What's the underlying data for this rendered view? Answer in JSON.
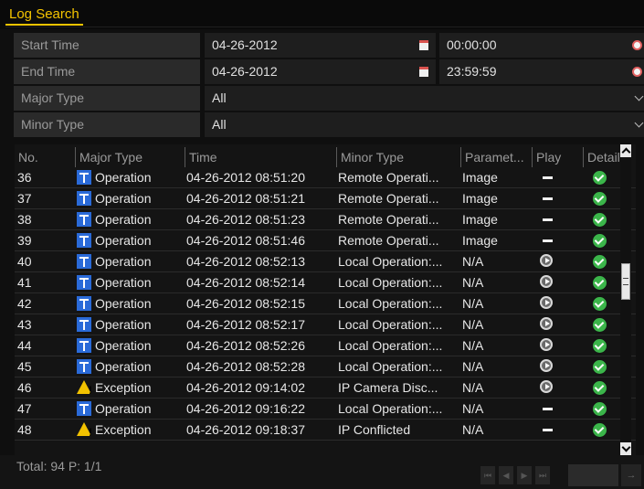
{
  "title_tab": "Log Search",
  "filters": {
    "start": {
      "label": "Start Time",
      "date": "04-26-2012",
      "time": "00:00:00"
    },
    "end": {
      "label": "End Time",
      "date": "04-26-2012",
      "time": "23:59:59"
    },
    "major": {
      "label": "Major Type",
      "value": "All"
    },
    "minor": {
      "label": "Minor Type",
      "value": "All"
    }
  },
  "columns": [
    "No.",
    "Major Type",
    "Time",
    "Minor Type",
    "Paramet...",
    "Play",
    "Details"
  ],
  "rows": [
    {
      "no": "36",
      "major": "Operation",
      "icon": "operation-icon",
      "time": "04-26-2012 08:51:20",
      "minor": "Remote Operati...",
      "param": "Image",
      "play": "none"
    },
    {
      "no": "37",
      "major": "Operation",
      "icon": "operation-icon",
      "time": "04-26-2012 08:51:21",
      "minor": "Remote Operati...",
      "param": "Image",
      "play": "none"
    },
    {
      "no": "38",
      "major": "Operation",
      "icon": "operation-icon",
      "time": "04-26-2012 08:51:23",
      "minor": "Remote Operati...",
      "param": "Image",
      "play": "none"
    },
    {
      "no": "39",
      "major": "Operation",
      "icon": "operation-icon",
      "time": "04-26-2012 08:51:46",
      "minor": "Remote Operati...",
      "param": "Image",
      "play": "none"
    },
    {
      "no": "40",
      "major": "Operation",
      "icon": "operation-icon",
      "time": "04-26-2012 08:52:13",
      "minor": "Local Operation:...",
      "param": "N/A",
      "play": "play"
    },
    {
      "no": "41",
      "major": "Operation",
      "icon": "operation-icon",
      "time": "04-26-2012 08:52:14",
      "minor": "Local Operation:...",
      "param": "N/A",
      "play": "play"
    },
    {
      "no": "42",
      "major": "Operation",
      "icon": "operation-icon",
      "time": "04-26-2012 08:52:15",
      "minor": "Local Operation:...",
      "param": "N/A",
      "play": "play"
    },
    {
      "no": "43",
      "major": "Operation",
      "icon": "operation-icon",
      "time": "04-26-2012 08:52:17",
      "minor": "Local Operation:...",
      "param": "N/A",
      "play": "play"
    },
    {
      "no": "44",
      "major": "Operation",
      "icon": "operation-icon",
      "time": "04-26-2012 08:52:26",
      "minor": "Local Operation:...",
      "param": "N/A",
      "play": "play"
    },
    {
      "no": "45",
      "major": "Operation",
      "icon": "operation-icon",
      "time": "04-26-2012 08:52:28",
      "minor": "Local Operation:...",
      "param": "N/A",
      "play": "play"
    },
    {
      "no": "46",
      "major": "Exception",
      "icon": "exception-icon",
      "time": "04-26-2012 09:14:02",
      "minor": "IP Camera Disc...",
      "param": "N/A",
      "play": "play"
    },
    {
      "no": "47",
      "major": "Operation",
      "icon": "operation-icon",
      "time": "04-26-2012 09:16:22",
      "minor": "Local Operation:...",
      "param": "N/A",
      "play": "none"
    },
    {
      "no": "48",
      "major": "Exception",
      "icon": "exception-icon",
      "time": "04-26-2012 09:18:37",
      "minor": "IP Conflicted",
      "param": "N/A",
      "play": "none"
    }
  ],
  "footer": {
    "total": "Total: 94  P: 1/1"
  },
  "pager": [
    "⏮",
    "◀",
    "▶",
    "⏭"
  ],
  "go_label": "→",
  "colors": {
    "accent": "#f5c400",
    "operation": "#2a6ad8",
    "exception": "#f2c200",
    "details": "#3bb54a"
  }
}
